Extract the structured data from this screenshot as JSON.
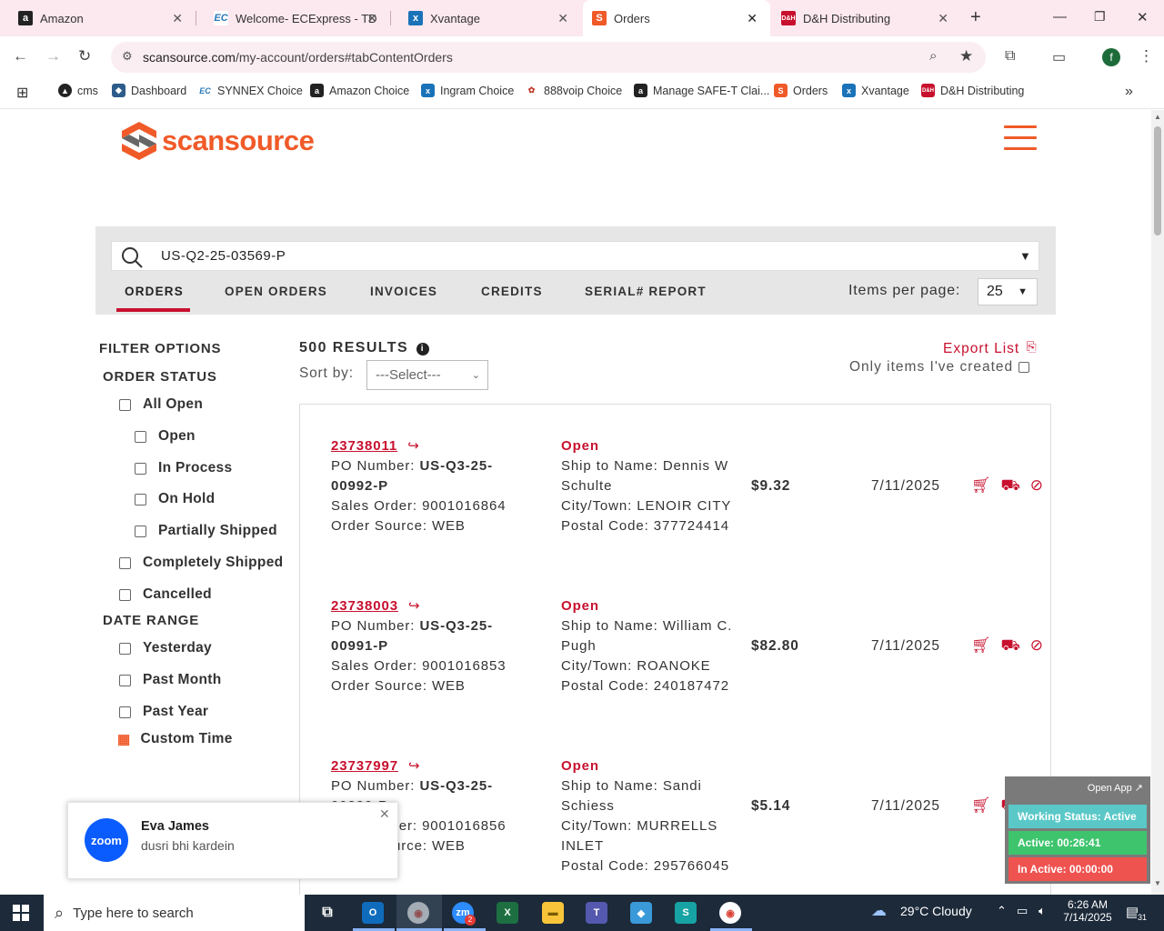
{
  "browser": {
    "tabs": [
      {
        "label": "Amazon",
        "icon": "amazon-icon"
      },
      {
        "label": "Welcome- ECExpress - TD",
        "icon": "ecexpress-icon"
      },
      {
        "label": "Xvantage",
        "icon": "xvantage-icon"
      },
      {
        "label": "Orders",
        "icon": "scansource-icon"
      },
      {
        "label": "D&H Distributing",
        "icon": "dh-icon"
      }
    ],
    "url_host": "scansource.com",
    "url_path": "/my-account/orders#tabContentOrders",
    "profile_initial": "f",
    "bookmarks": [
      {
        "label": "cms",
        "icon": "cms-icon"
      },
      {
        "label": "Dashboard",
        "icon": "dashboard-icon"
      },
      {
        "label": "SYNNEX Choice",
        "icon": "synnex-icon"
      },
      {
        "label": "Amazon Choice",
        "icon": "amazon-icon"
      },
      {
        "label": "Ingram Choice",
        "icon": "ingram-icon"
      },
      {
        "label": "888voip Choice",
        "icon": "voip-icon"
      },
      {
        "label": "Manage SAFE-T Clai...",
        "icon": "amazon-icon"
      },
      {
        "label": "Orders",
        "icon": "scansource-icon"
      },
      {
        "label": "Xvantage",
        "icon": "xvantage-icon"
      },
      {
        "label": "D&H Distributing",
        "icon": "dh-icon"
      }
    ]
  },
  "site": {
    "logo_text": "scansource",
    "brand_colors": {
      "orange": "#f05a28",
      "red": "#c8102e",
      "gray": "#666666"
    }
  },
  "search": {
    "value": "US-Q2-25-03569-P"
  },
  "tabs": [
    {
      "label": "ORDERS",
      "active": true
    },
    {
      "label": "OPEN ORDERS",
      "active": false
    },
    {
      "label": "INVOICES",
      "active": false
    },
    {
      "label": "CREDITS",
      "active": false
    },
    {
      "label": "SERIAL# REPORT",
      "active": false
    }
  ],
  "items_per_page": {
    "label": "Items per page:",
    "value": "25"
  },
  "filters": {
    "title": "FILTER OPTIONS",
    "order_status_title": "ORDER STATUS",
    "order_status": [
      {
        "label": "All Open",
        "checked": false,
        "indent": false
      },
      {
        "label": "Open",
        "checked": false,
        "indent": true
      },
      {
        "label": "In Process",
        "checked": false,
        "indent": true
      },
      {
        "label": "On Hold",
        "checked": false,
        "indent": true
      },
      {
        "label": "Partially Shipped",
        "checked": false,
        "indent": true
      },
      {
        "label": "Completely Shipped",
        "checked": false,
        "indent": false
      },
      {
        "label": "Cancelled",
        "checked": false,
        "indent": false
      }
    ],
    "date_range_title": "DATE RANGE",
    "date_range": [
      {
        "label": "Yesterday",
        "checked": false
      },
      {
        "label": "Past Month",
        "checked": false
      },
      {
        "label": "Past Year",
        "checked": false
      }
    ],
    "custom_time": "Custom Time"
  },
  "results": {
    "count_label": "500 RESULTS",
    "sort_label": "Sort by:",
    "sort_value": "---Select---",
    "export_label": "Export List",
    "only_mine_label": "Only items I've created"
  },
  "orders": [
    {
      "number": "23738011",
      "po_label": "PO Number: ",
      "po_line1": "US-Q3-25-",
      "po_line2": "00992-P",
      "sales_order": "Sales Order: 9001016864",
      "order_source": "Order Source: WEB",
      "status": "Open",
      "ship_name_line1": "Ship to Name: Dennis W",
      "ship_name_line2": "Schulte",
      "city_line1": "City/Town: LENOIR CITY",
      "city_line2": "",
      "postal": "Postal Code: 377724414",
      "amount": "$9.32",
      "date": "7/11/2025"
    },
    {
      "number": "23738003",
      "po_label": "PO Number: ",
      "po_line1": "US-Q3-25-",
      "po_line2": "00991-P",
      "sales_order": "Sales Order: 9001016853",
      "order_source": "Order Source: WEB",
      "status": "Open",
      "ship_name_line1": "Ship to Name: William C.",
      "ship_name_line2": "Pugh",
      "city_line1": "City/Town: ROANOKE",
      "city_line2": "",
      "postal": "Postal Code: 240187472",
      "amount": "$82.80",
      "date": "7/11/2025"
    },
    {
      "number": "23737997",
      "po_label": "PO Number: ",
      "po_line1": "US-Q3-25-",
      "po_line2": "00990-P",
      "sales_order": "Sales Order: 9001016856",
      "order_source": "Order Source: WEB",
      "status": "Open",
      "ship_name_line1": "Ship to Name: Sandi",
      "ship_name_line2": "Schiess",
      "city_line1": "City/Town: MURRELLS",
      "city_line2": "INLET",
      "postal": "Postal Code: 295766045",
      "amount": "$5.14",
      "date": "7/11/2025"
    }
  ],
  "zoom_toast": {
    "app": "zoom",
    "name": "Eva James",
    "message": "dusri bhi kardein"
  },
  "status_widget": {
    "open_app": "Open App ↗",
    "working": "Working Status: Active",
    "active": "Active: 00:26:41",
    "inactive": "In Active: 00:00:00"
  },
  "taskbar": {
    "search_placeholder": "Type here to search",
    "weather": "29°C  Cloudy",
    "time": "6:26 AM",
    "date": "7/14/2025",
    "notifications": "31",
    "zoom_badge": "2"
  }
}
